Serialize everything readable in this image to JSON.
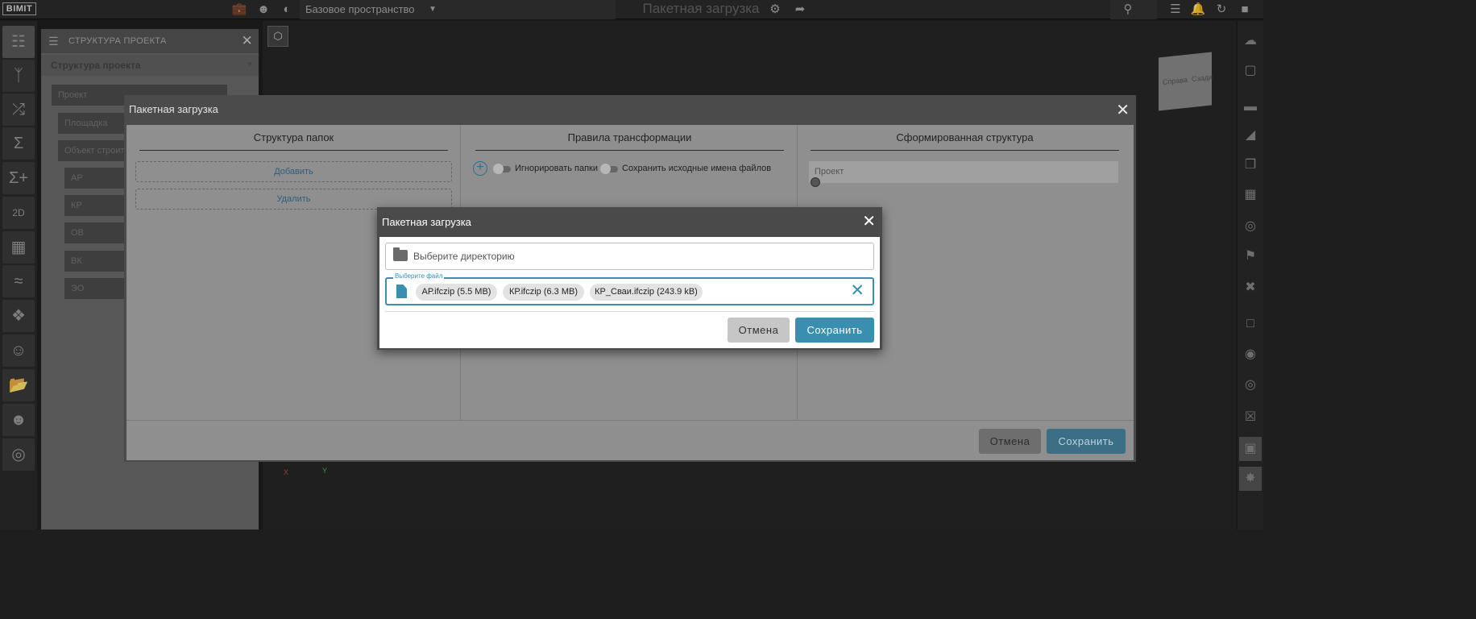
{
  "topbar": {
    "logo": "BIMIT",
    "workspace": "Базовое пространство",
    "app_title": "Пакетная загрузка"
  },
  "structure_panel": {
    "header": "СТРУКТУРА ПРОЕКТА",
    "subheader": "Структура проекта",
    "items": [
      "Проект",
      "Площадка",
      "Объект строите",
      "АР",
      "КР",
      "ОВ",
      "ВК",
      "ЭО"
    ]
  },
  "navcube": {
    "left_label": "Справа",
    "right_label": "Сзади"
  },
  "outer_dialog": {
    "title": "Пакетная загрузка",
    "columns": {
      "folders": "Структура папок",
      "rules": "Правила трансформации",
      "result": "Сформированная структура"
    },
    "add_label": "Добавить",
    "remove_label": "Удалить",
    "ignore_folders_label": "Игнорировать папки",
    "keep_names_label": "Сохранить исходные имена файлов",
    "result_root": "Проект",
    "cancel_label": "Отмена",
    "save_label": "Сохранить"
  },
  "inner_dialog": {
    "title": "Пакетная загрузка",
    "directory_placeholder": "Выберите директорию",
    "file_legend": "Выберите файл",
    "files": [
      "АР.ifczip (5.5 MB)",
      "КР.ifczip (6.3 MB)",
      "КР_Сваи.ifczip (243.9 kB)"
    ],
    "cancel_label": "Отмена",
    "save_label": "Сохранить"
  },
  "axis_labels": {
    "x": "X",
    "y": "Y"
  }
}
